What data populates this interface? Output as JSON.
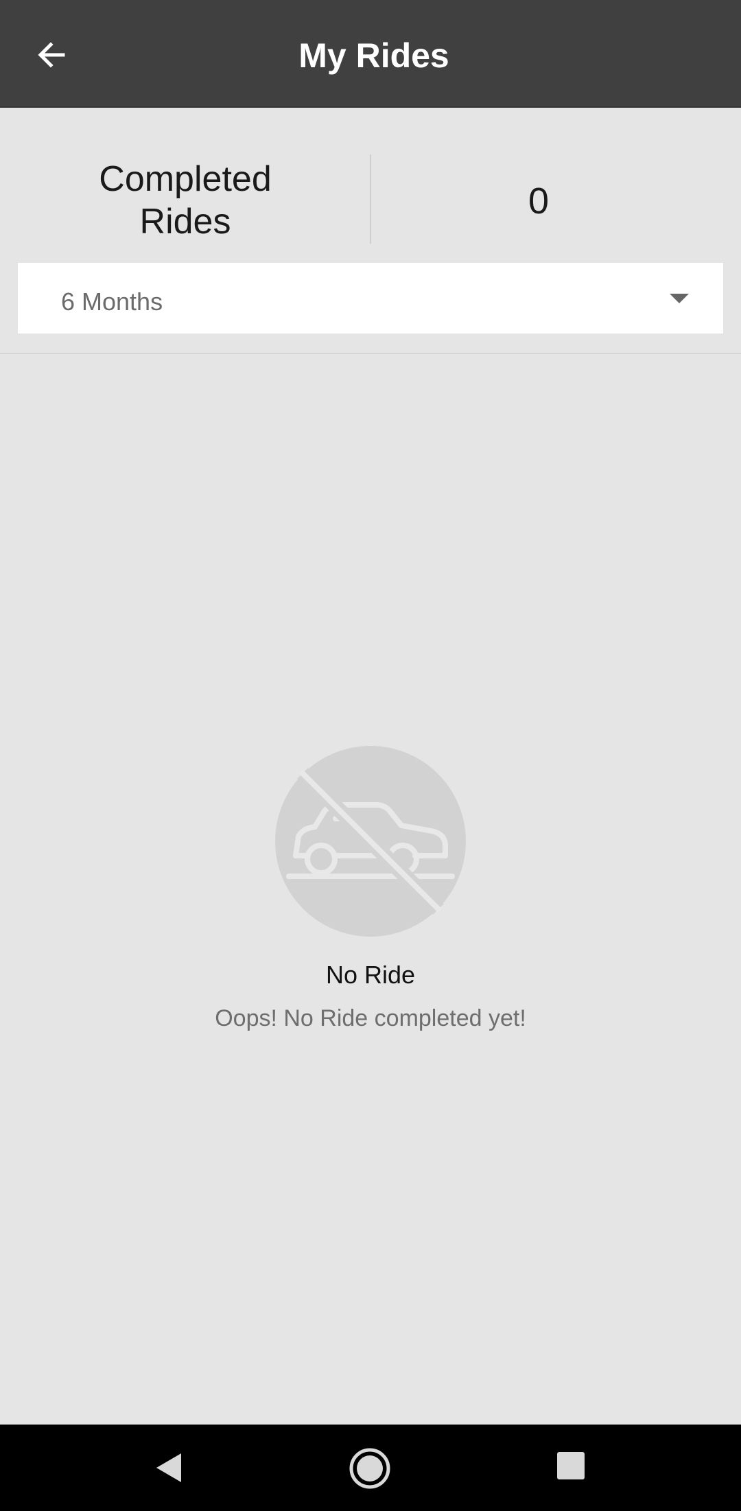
{
  "app_bar": {
    "title": "My Rides",
    "back_icon": "arrow-left-icon"
  },
  "summary": {
    "label": "Completed Rides",
    "value": "0"
  },
  "period_select": {
    "selected": "6 Months",
    "dropdown_icon": "caret-down-icon"
  },
  "empty_state": {
    "icon": "no-car-icon",
    "title": "No Ride",
    "message": "Oops! No Ride completed yet!"
  },
  "nav_bar": {
    "back_icon": "nav-back-icon",
    "home_icon": "nav-home-icon",
    "recents_icon": "nav-recents-icon"
  },
  "colors": {
    "app_bar": "#404040",
    "background": "#e5e5e5",
    "illustration": "#d2d2d2"
  }
}
